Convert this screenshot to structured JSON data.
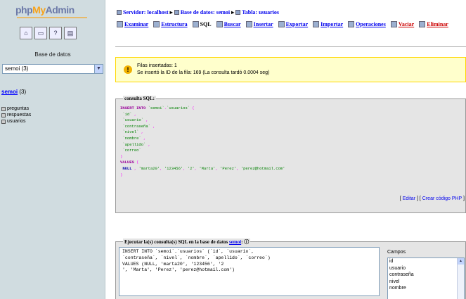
{
  "sidebar": {
    "logo": {
      "part1": "php",
      "part2": "My",
      "part3": "Admin"
    },
    "icons": [
      "home-icon",
      "query-window-icon",
      "sql-help-icon",
      "docs-icon"
    ],
    "db_label": "Base de datos",
    "db_select_value": "semoi (3)",
    "db_name": "semoi",
    "db_count": "(3)",
    "tables": [
      "preguntas",
      "respuestas",
      "usuarios"
    ]
  },
  "breadcrumb": {
    "server": "Servidor: localhost",
    "database": "Base de datos: semoi",
    "table": "Tabla: usuarios",
    "separator": "▸"
  },
  "tabs": [
    {
      "label": "Examinar",
      "icon": "browse-icon"
    },
    {
      "label": "Estructura",
      "icon": "structure-icon"
    },
    {
      "label": "SQL",
      "icon": "sql-icon",
      "active": true
    },
    {
      "label": "Buscar",
      "icon": "search-icon"
    },
    {
      "label": "Insertar",
      "icon": "insert-icon"
    },
    {
      "label": "Exportar",
      "icon": "export-icon"
    },
    {
      "label": "Importar",
      "icon": "import-icon"
    },
    {
      "label": "Operaciones",
      "icon": "operations-icon"
    },
    {
      "label": "Vaciar",
      "icon": "empty-icon",
      "danger": true
    },
    {
      "label": "Eliminar",
      "icon": "drop-icon",
      "danger": true
    }
  ],
  "notice": {
    "line1": "Filas insertadas: 1",
    "line2": "Se insertó la ID de la fila: 169 (La consulta tardó 0.0004 seg)"
  },
  "sql_box": {
    "legend": "consulta SQL:",
    "links": {
      "edit": "Editar",
      "php": "Crear código PHP"
    }
  },
  "exec_box": {
    "legend_prefix": "Ejecutar la(s) consulta(s) SQL en la base de datos",
    "legend_db": "semoi",
    "query": "INSERT INTO `semoi`.`usuarios` (`id`, `usuario`,\n`contraseña`, `nivel`, `nombre`, `apellido`, `correo`)\nVALUES (NULL, 'marta20', '123456', '2\n', 'Marta', 'Perez', 'perez@hotmail.com')",
    "fields_label": "Campos",
    "fields": [
      "id",
      "usuario",
      "contraseña",
      "nivel",
      "nombre"
    ]
  }
}
